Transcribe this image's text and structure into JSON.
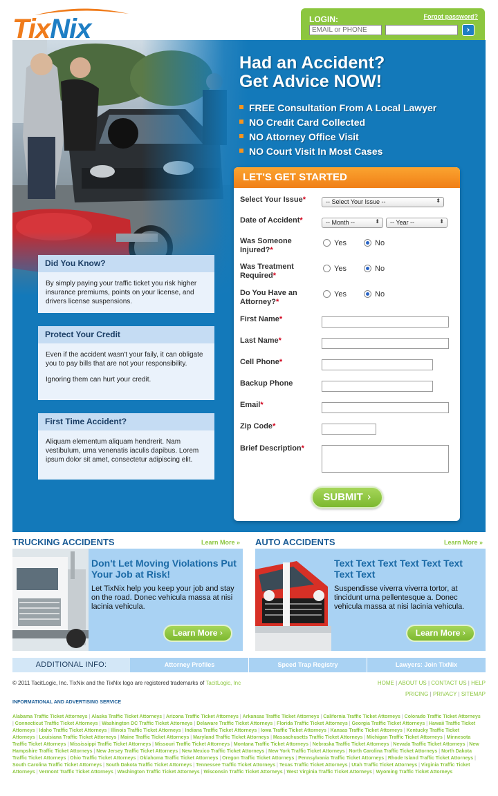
{
  "brand": {
    "part1": "Tix",
    "part2": "Nix"
  },
  "login": {
    "label": "LOGIN:",
    "forgot": "Forgot password?",
    "user_placeholder": "EMAIL or PHONE",
    "password_placeholder": ""
  },
  "hero": {
    "headline_line1": "Had an Accident?",
    "headline_line2": "Get Advice NOW!",
    "bullets": [
      "FREE Consultation From A Local Lawyer",
      "NO Credit Card Collected",
      "NO Attorney Office Visit",
      "NO Court Visit In Most Cases"
    ]
  },
  "info_boxes": [
    {
      "title": "Did You Know?",
      "paragraphs": [
        "By simply paying your traffic ticket you risk higher insurance premiums, points on your license, and drivers license suspensions."
      ]
    },
    {
      "title": "Protect Your Credit",
      "paragraphs": [
        "Even if the accident wasn't your faily, it can obligate you to pay bills that are not your responsibility.",
        "Ignoring them can hurt your credit."
      ]
    },
    {
      "title": "First Time Accident?",
      "paragraphs": [
        "Aliquam elementum aliquam hendrerit. Nam vestibulum, urna venenatis iaculis dapibus. Lorem ipsum dolor sit amet, consectetur adipiscing elit."
      ]
    }
  ],
  "form": {
    "title": "LET'S GET STARTED",
    "issue": {
      "label": "Select Your Issue",
      "value": "-- Select Your Issue --"
    },
    "date": {
      "label": "Date of Accident",
      "month": "-- Month --",
      "year": "-- Year --"
    },
    "injured": {
      "label_line1": "Was Someone",
      "label_line2": "Injured?",
      "yes": "Yes",
      "no": "No",
      "selected": "No"
    },
    "treatment": {
      "label_line1": "Was Treatment",
      "label_line2": "Required",
      "yes": "Yes",
      "no": "No",
      "selected": "No"
    },
    "attorney": {
      "label_line1": "Do You Have an",
      "label_line2": "Attorney?",
      "yes": "Yes",
      "no": "No",
      "selected": "No"
    },
    "first_name": "First Name",
    "last_name": "Last Name",
    "cell_phone": "Cell Phone",
    "backup_phone": "Backup Phone",
    "email": "Email",
    "zip": "Zip Code",
    "description": "Brief Description",
    "required_mark": "*",
    "submit": "SUBMIT"
  },
  "promos": {
    "trucking": {
      "title": "TRUCKING ACCIDENTS",
      "more": "Learn More »",
      "heading": "Don't Let Moving Violations Put Your Job at Risk!",
      "text": "Let TixNix help you keep your job and stay on the road. Donec vehicula massa at nisi lacinia vehicula.",
      "button": "Learn More"
    },
    "auto": {
      "title": "AUTO ACCIDENTS",
      "more": "Learn More »",
      "heading": "Text Text Text Text Text Text Text Text",
      "text": "Suspendisse viverra viverra tortor, at tincidunt urna pellentesque a. Donec vehicula massa at nisi lacinia vehicula.",
      "button": "Learn More"
    }
  },
  "additional": {
    "label": "ADDITIONAL INFO:",
    "links": [
      "Attorney Profiles",
      "Speed Trap Registry",
      "Lawyers: Join TixNix"
    ]
  },
  "footer": {
    "copyright_prefix": "© 2011 TacitLogic, Inc. TixNix and the TixNix logo are registered trademarks of ",
    "copyright_link": "TacitLogic, Inc",
    "nav_row1": [
      "HOME",
      "ABOUT US",
      "CONTACT US",
      "HELP"
    ],
    "nav_row2": [
      "PRICING",
      "PRIVACY",
      "SITEMAP"
    ],
    "info_heading": "INFORMATIONAL AND ADVERTISING SERVICE",
    "states": [
      "Alabama Traffic Ticket Attorneys",
      "Alaska Traffic Ticket Attorneys",
      "Arizona Traffic Ticket Attorneys",
      "Arkansas Traffic Ticket Attorneys",
      "California Traffic Ticket Attorneys",
      "Colorado Traffic Ticket Attorneys",
      "Connecticut Traffic Ticket Attorneys",
      "Washington DC Traffic Ticket Attorneys",
      "Delaware Traffic Ticket Attorneys",
      "Florida Traffic Ticket Attorneys",
      "Georgia Traffic Ticket Attorneys",
      "Hawaii Traffic Ticket Attorneys",
      "Idaho Traffic Ticket Attorneys",
      "Illinois Traffic Ticket Attorneys",
      "Indiana Traffic Ticket Attorneys",
      "Iowa Traffic Ticket Attorneys",
      "Kansas Traffic Ticket Attorneys",
      "Kentucky Traffic Ticket Attorneys",
      "Louisiana Traffic Ticket Attorneys",
      "Maine Traffic Ticket Attorneys",
      "Maryland Traffic Ticket Attorneys",
      "Massachusetts Traffic Ticket Attorneys",
      "Michigan Traffic Ticket Attorneys",
      "Minnesota Traffic Ticket Attorneys",
      "Mississippi Traffic Ticket Attorneys",
      "Missouri Traffic Ticket Attorneys",
      "Montana Traffic Ticket Attorneys",
      "Nebraska Traffic Ticket Attorneys",
      "Nevada Traffic Ticket Attorneys",
      "New Hampshire Traffic Ticket Attorneys",
      "New Jersey Traffic Ticket Attorneys",
      "New Mexico Traffic Ticket Attorneys",
      "New York Traffic Ticket Attorneys",
      "North Carolina Traffic Ticket Attorneys",
      "North Dakota Traffic Ticket Attorneys",
      "Ohio Traffic Ticket Attorneys",
      "Oklahoma Traffic Ticket Attorneys",
      "Oregon Traffic Ticket Attorneys",
      "Pennsylvania Traffic Ticket Attorneys",
      "Rhode Island Traffic Ticket Attorneys",
      "South Carolina Traffic Ticket Attorneys",
      "South Dakota Traffic Ticket Attorneys",
      "Tennessee Traffic Ticket Attorneys",
      "Texas Traffic Ticket Attorneys",
      "Utah Traffic Ticket Attorneys",
      "Virginia Traffic Ticket Attorneys",
      "Vermont Traffic Ticket Attorneys",
      "Washington Traffic Ticket Attorneys",
      "Wisconsin Traffic Ticket Attorneys",
      "West Virginia Traffic Ticket Attorneys",
      "Wyoming Traffic Ticket Attorneys"
    ]
  },
  "colors": {
    "brand_orange": "#f07c1c",
    "brand_blue": "#1e7ec4",
    "hero_blue": "#1379ba",
    "accent_green": "#8cc63f",
    "panel_light_blue": "#a9d2f3"
  },
  "icons": [
    "swoosh-icon",
    "go-arrow-icon",
    "bullet-square-icon",
    "chevron-right-icon",
    "select-arrows-icon",
    "radio-icon"
  ]
}
